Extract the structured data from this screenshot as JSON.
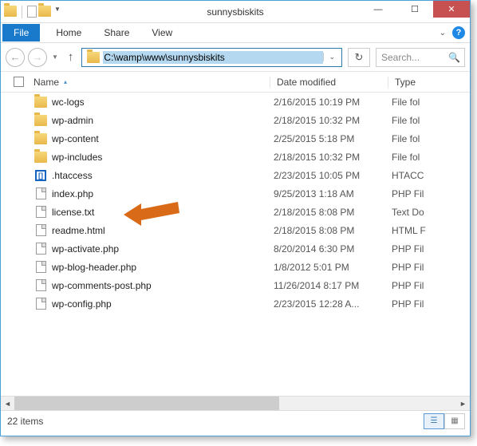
{
  "window": {
    "title": "sunnysbiskits"
  },
  "tabs": {
    "file": "File",
    "home": "Home",
    "share": "Share",
    "view": "View"
  },
  "nav": {
    "path": "C:\\wamp\\www\\sunnysbiskits",
    "search_placeholder": "Search..."
  },
  "columns": {
    "name": "Name",
    "date": "Date modified",
    "type": "Type"
  },
  "files": [
    {
      "icon": "folder",
      "name": "wc-logs",
      "date": "2/16/2015 10:19 PM",
      "type": "File fol"
    },
    {
      "icon": "folder",
      "name": "wp-admin",
      "date": "2/18/2015 10:32 PM",
      "type": "File fol"
    },
    {
      "icon": "folder",
      "name": "wp-content",
      "date": "2/25/2015 5:18 PM",
      "type": "File fol"
    },
    {
      "icon": "folder",
      "name": "wp-includes",
      "date": "2/18/2015 10:32 PM",
      "type": "File fol"
    },
    {
      "icon": "htaccess",
      "name": ".htaccess",
      "date": "2/23/2015 10:05 PM",
      "type": "HTACC"
    },
    {
      "icon": "file",
      "name": "index.php",
      "date": "9/25/2013 1:18 AM",
      "type": "PHP Fil"
    },
    {
      "icon": "file",
      "name": "license.txt",
      "date": "2/18/2015 8:08 PM",
      "type": "Text Do"
    },
    {
      "icon": "file",
      "name": "readme.html",
      "date": "2/18/2015 8:08 PM",
      "type": "HTML F"
    },
    {
      "icon": "file",
      "name": "wp-activate.php",
      "date": "8/20/2014 6:30 PM",
      "type": "PHP Fil"
    },
    {
      "icon": "file",
      "name": "wp-blog-header.php",
      "date": "1/8/2012 5:01 PM",
      "type": "PHP Fil"
    },
    {
      "icon": "file",
      "name": "wp-comments-post.php",
      "date": "11/26/2014 8:17 PM",
      "type": "PHP Fil"
    },
    {
      "icon": "file",
      "name": "wp-config.php",
      "date": "2/23/2015 12:28 A...",
      "type": "PHP Fil"
    }
  ],
  "status": {
    "items": "22 items"
  }
}
